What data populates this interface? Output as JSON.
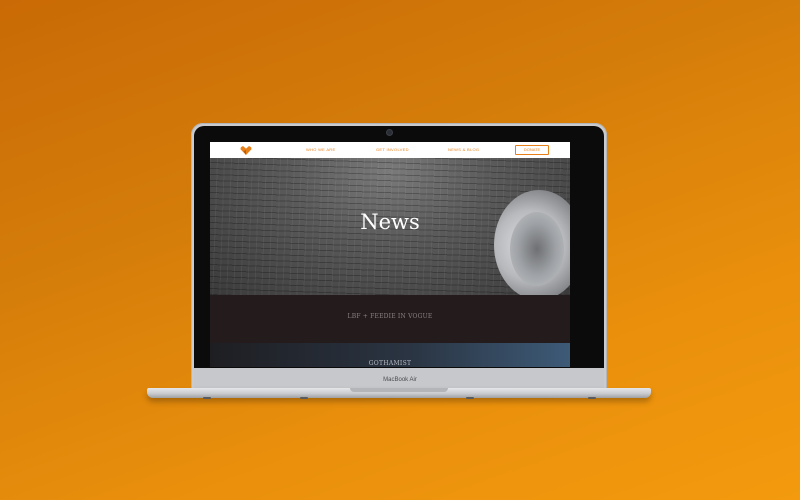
{
  "device": {
    "brand_label": "MacBook Air"
  },
  "site": {
    "nav": {
      "links": [
        "WHO WE ARE",
        "GET INVOLVED",
        "NEWS & BLOG"
      ],
      "donate_label": "DONATE"
    },
    "hero": {
      "title": "News"
    },
    "posts": [
      {
        "title": "LBF + FEEDIE IN VOGUE"
      },
      {
        "title": "GOTHAMIST"
      }
    ]
  },
  "colors": {
    "accent": "#e8801a",
    "background_gradient_start": "#c96a06",
    "background_gradient_end": "#f39a0e"
  },
  "icons": [
    "heart-logo-icon"
  ]
}
